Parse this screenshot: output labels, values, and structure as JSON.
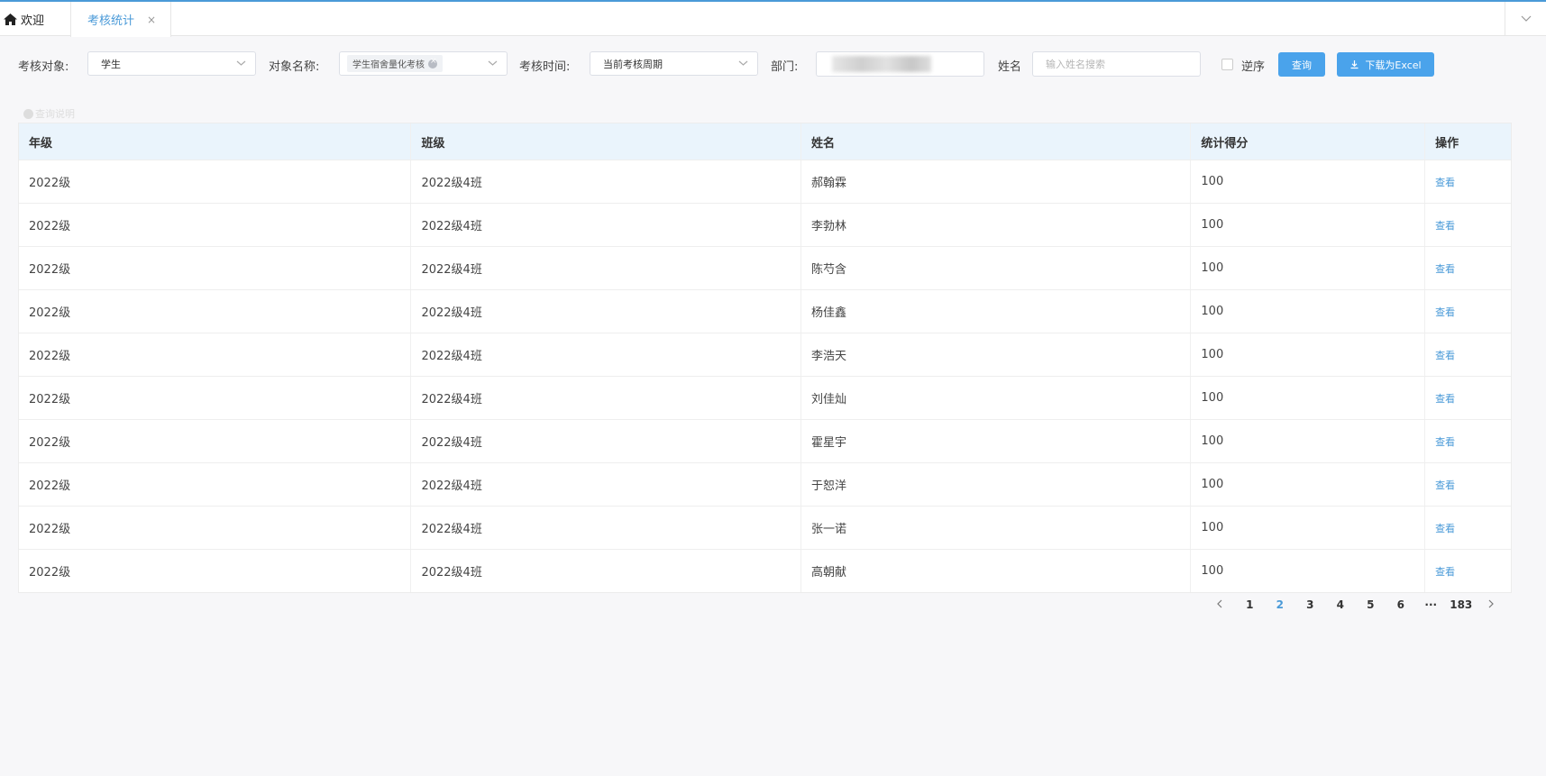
{
  "tabs": {
    "home_label": "欢迎",
    "active_label": "考核统计",
    "close_symbol": "×"
  },
  "filters": {
    "target_label": "考核对象:",
    "target_value": "学生",
    "object_label": "对象名称:",
    "object_chip": "学生宿舍量化考核",
    "time_label": "考核时间:",
    "time_value": "当前考核周期",
    "dept_label": "部门:",
    "name_label": "姓名",
    "name_placeholder": "输入姓名搜索",
    "reverse_label": "逆序",
    "query_button": "查询",
    "download_button": "下载为Excel"
  },
  "hint_text": "查询说明",
  "table": {
    "headers": [
      "年级",
      "班级",
      "姓名",
      "统计得分",
      "操作"
    ],
    "rows": [
      {
        "grade": "2022级",
        "class": "2022级4班",
        "name": "郝翰霖",
        "score": "100",
        "action": "查看"
      },
      {
        "grade": "2022级",
        "class": "2022级4班",
        "name": "李勃林",
        "score": "100",
        "action": "查看"
      },
      {
        "grade": "2022级",
        "class": "2022级4班",
        "name": "陈芍含",
        "score": "100",
        "action": "查看"
      },
      {
        "grade": "2022级",
        "class": "2022级4班",
        "name": "杨佳鑫",
        "score": "100",
        "action": "查看"
      },
      {
        "grade": "2022级",
        "class": "2022级4班",
        "name": "李浩天",
        "score": "100",
        "action": "查看"
      },
      {
        "grade": "2022级",
        "class": "2022级4班",
        "name": "刘佳灿",
        "score": "100",
        "action": "查看"
      },
      {
        "grade": "2022级",
        "class": "2022级4班",
        "name": "霍星宇",
        "score": "100",
        "action": "查看"
      },
      {
        "grade": "2022级",
        "class": "2022级4班",
        "name": "于恕洋",
        "score": "100",
        "action": "查看"
      },
      {
        "grade": "2022级",
        "class": "2022级4班",
        "name": "张一诺",
        "score": "100",
        "action": "查看"
      },
      {
        "grade": "2022级",
        "class": "2022级4班",
        "name": "高朝献",
        "score": "100",
        "action": "查看"
      }
    ]
  },
  "pagination": {
    "pages": [
      "1",
      "2",
      "3",
      "4",
      "5",
      "6",
      "···",
      "183"
    ],
    "current": "2"
  },
  "colors": {
    "accent": "#4a9ad8",
    "button": "#4aa3eb",
    "header_bg": "#eaf4fc"
  },
  "icons": {
    "home": "home-icon",
    "dropdown": "chevron-down-icon",
    "download": "download-icon",
    "prev": "chevron-left-icon",
    "next": "chevron-right-icon"
  }
}
